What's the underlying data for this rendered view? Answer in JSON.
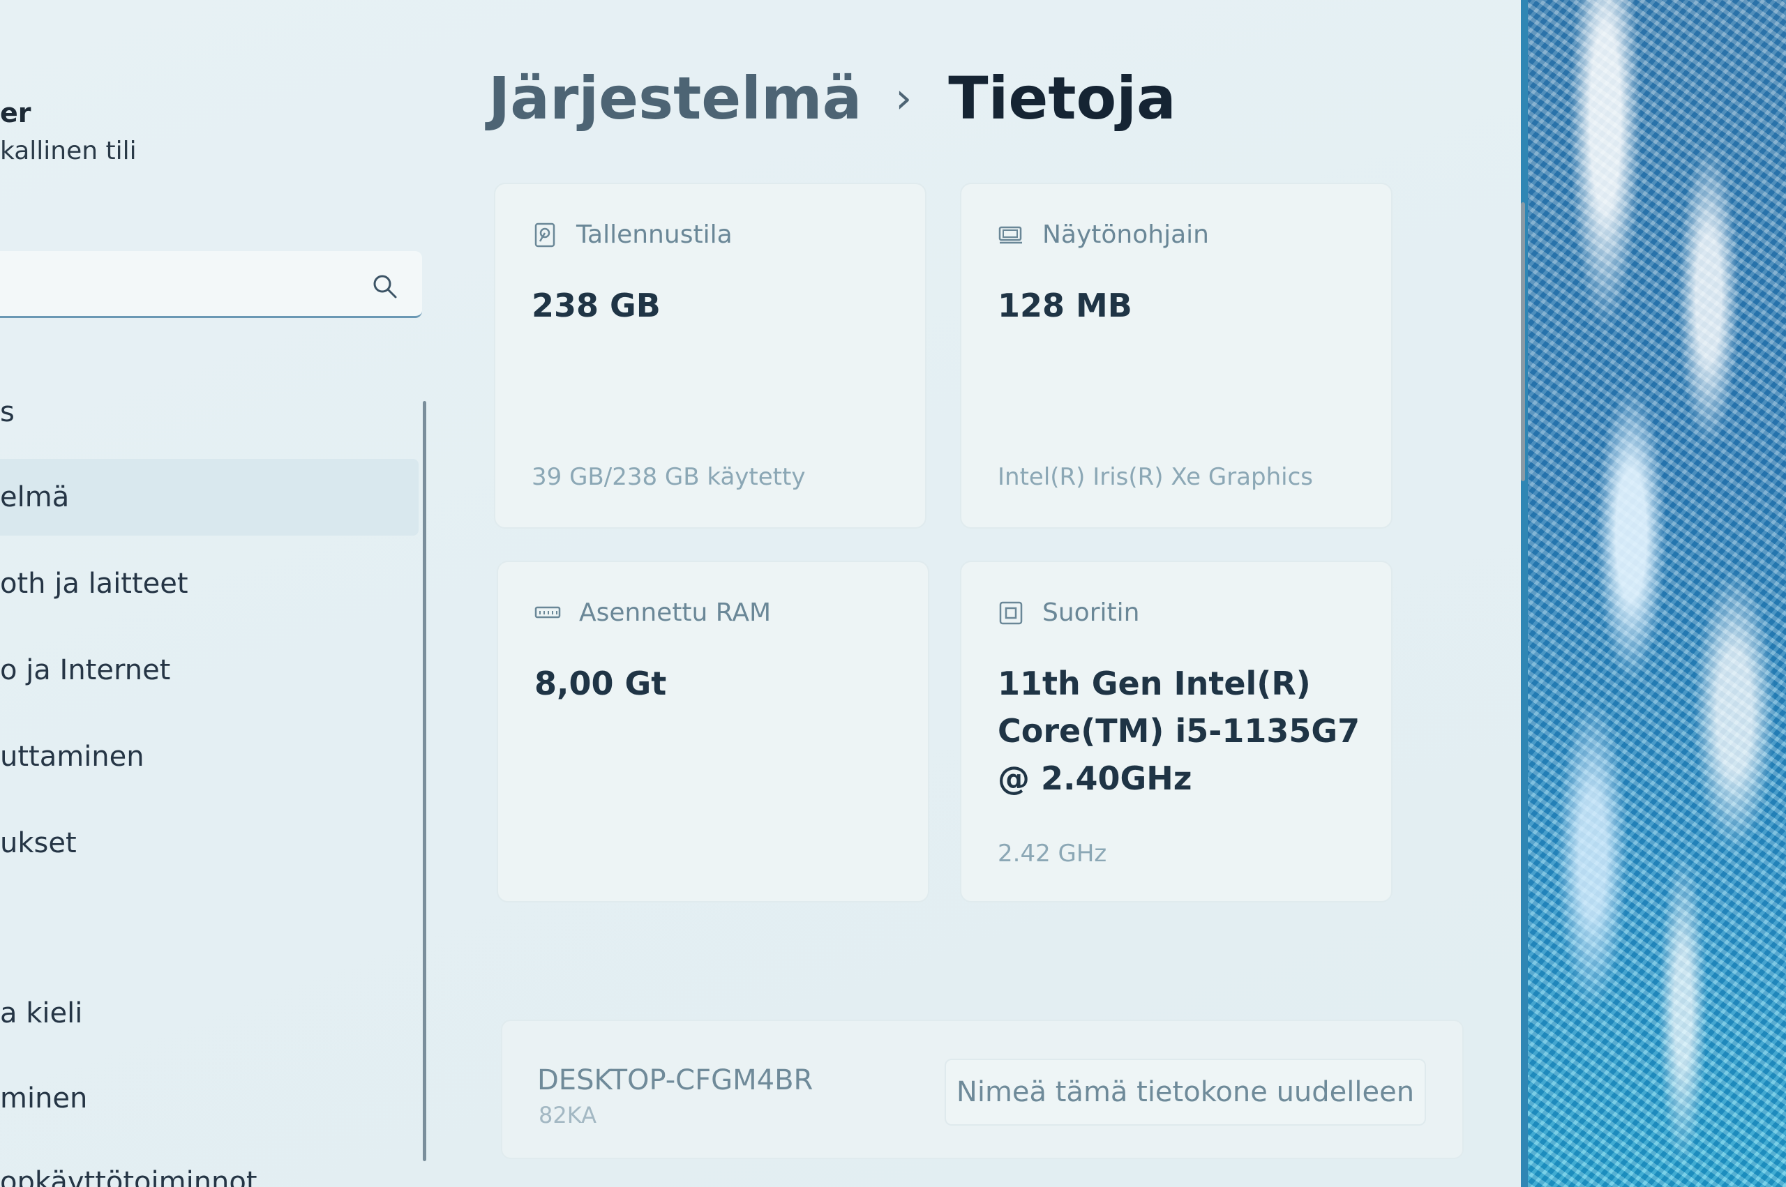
{
  "sidebar": {
    "account_name": "er",
    "account_type": "kallinen tili",
    "items": [
      {
        "label": "s"
      },
      {
        "label": "elmä"
      },
      {
        "label": "oth ja laitteet"
      },
      {
        "label": "o ja Internet"
      },
      {
        "label": "uttaminen"
      },
      {
        "label": "ukset"
      },
      {
        "label": "a kieli"
      },
      {
        "label": "minen"
      },
      {
        "label": "opkäyttötoiminnot"
      }
    ]
  },
  "header": {
    "parent": "Järjestelmä",
    "separator": "›",
    "current": "Tietoja"
  },
  "cards": {
    "storage": {
      "label": "Tallennustila",
      "value": "238 GB",
      "sub": "39 GB/238 GB käytetty",
      "icon": "storage-icon"
    },
    "gpu": {
      "label": "Näytönohjain",
      "value": "128 MB",
      "sub": "Intel(R) Iris(R) Xe Graphics",
      "icon": "display-adapter-icon"
    },
    "ram": {
      "label": "Asennettu RAM",
      "value": "8,00 Gt",
      "sub": "",
      "icon": "ram-icon"
    },
    "cpu": {
      "label": "Suoritin",
      "value": "11th Gen Intel(R) Core(TM) i5-1135G7 @ 2.40GHz",
      "sub": "2.42 GHz",
      "icon": "processor-icon"
    }
  },
  "device": {
    "name": "DESKTOP-CFGM4BR",
    "model": "82KA",
    "rename_label": "Nimeä tämä tietokone uudelleen"
  },
  "colors": {
    "window_bg": "#e4eff3",
    "card_bg": "#edf4f5",
    "accent_underline": "#6a98b4",
    "title_text": "#152433"
  }
}
